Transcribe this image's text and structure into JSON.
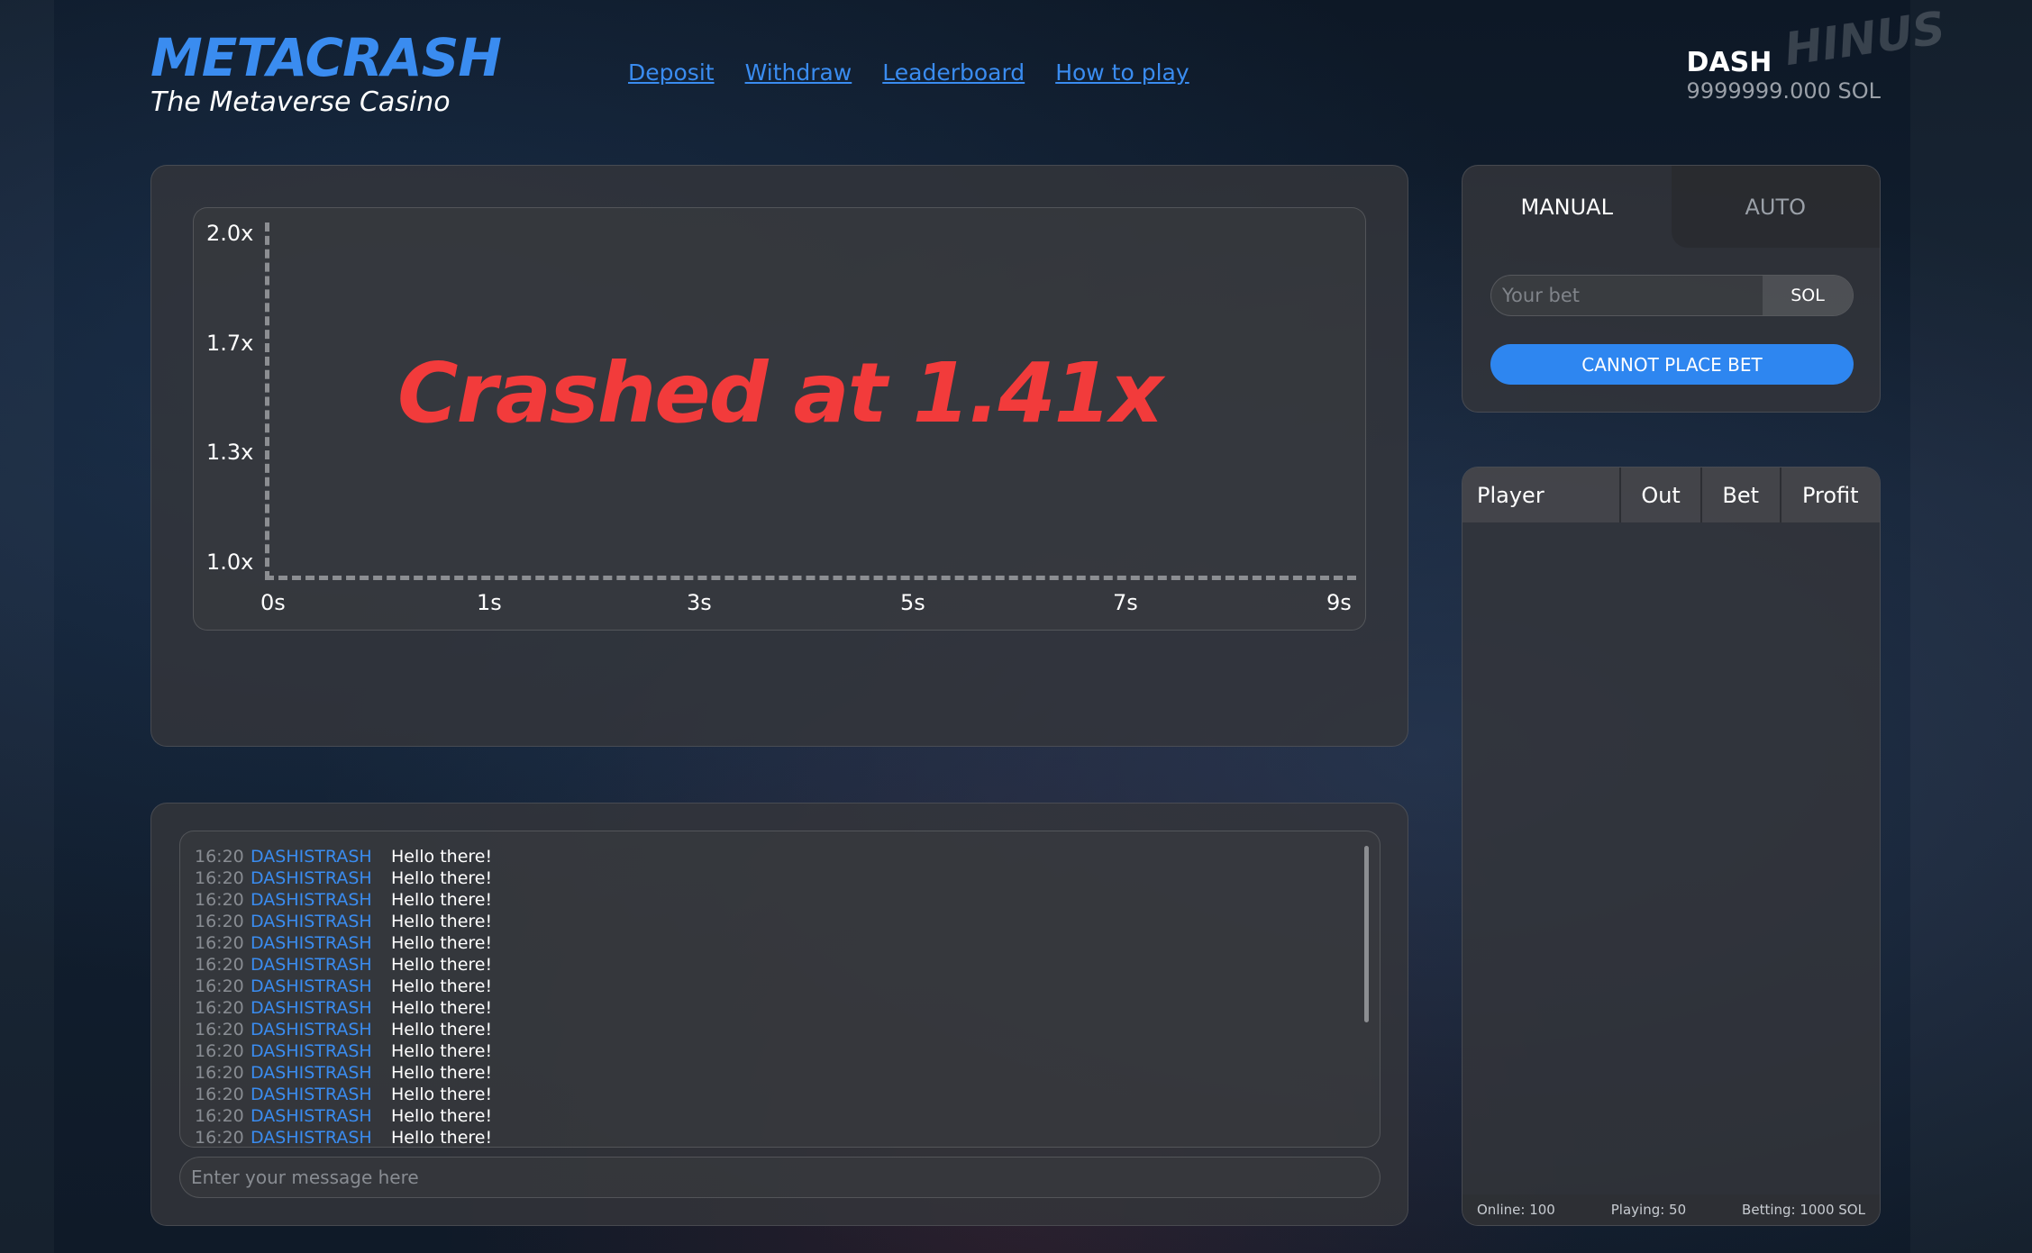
{
  "header": {
    "logo_title": "METACRASH",
    "logo_subtitle": "The Metaverse Casino",
    "nav": [
      "Deposit",
      "Withdraw",
      "Leaderboard",
      "How to play"
    ],
    "user_name": "DASH",
    "user_balance": "9999999.000 SOL",
    "watermark": "HINUS"
  },
  "game": {
    "y_ticks": [
      "2.0x",
      "1.7x",
      "1.3x",
      "1.0x"
    ],
    "x_ticks": [
      "0s",
      "1s",
      "3s",
      "5s",
      "7s",
      "9s"
    ],
    "crash_text": "Crashed at 1.41x",
    "crash_multiplier": 1.41
  },
  "chat": {
    "messages": [
      {
        "time": "16:20",
        "user": "DASHISTRASH",
        "text": "Hello there!"
      },
      {
        "time": "16:20",
        "user": "DASHISTRASH",
        "text": "Hello there!"
      },
      {
        "time": "16:20",
        "user": "DASHISTRASH",
        "text": "Hello there!"
      },
      {
        "time": "16:20",
        "user": "DASHISTRASH",
        "text": "Hello there!"
      },
      {
        "time": "16:20",
        "user": "DASHISTRASH",
        "text": "Hello there!"
      },
      {
        "time": "16:20",
        "user": "DASHISTRASH",
        "text": "Hello there!"
      },
      {
        "time": "16:20",
        "user": "DASHISTRASH",
        "text": "Hello there!"
      },
      {
        "time": "16:20",
        "user": "DASHISTRASH",
        "text": "Hello there!"
      },
      {
        "time": "16:20",
        "user": "DASHISTRASH",
        "text": "Hello there!"
      },
      {
        "time": "16:20",
        "user": "DASHISTRASH",
        "text": "Hello there!"
      },
      {
        "time": "16:20",
        "user": "DASHISTRASH",
        "text": "Hello there!"
      },
      {
        "time": "16:20",
        "user": "DASHISTRASH",
        "text": "Hello there!"
      },
      {
        "time": "16:20",
        "user": "DASHISTRASH",
        "text": "Hello there!"
      },
      {
        "time": "16:20",
        "user": "DASHISTRASH",
        "text": "Hello there!"
      }
    ],
    "input_placeholder": "Enter your message here"
  },
  "bet": {
    "tab_manual": "MANUAL",
    "tab_auto": "AUTO",
    "active_tab": "MANUAL",
    "bet_placeholder": "Your bet",
    "currency": "SOL",
    "button_label": "CANNOT PLACE BET"
  },
  "players": {
    "columns": [
      "Player",
      "Out",
      "Bet",
      "Profit"
    ],
    "rows": [],
    "online": "Online: 100",
    "playing": "Playing: 50",
    "betting": "Betting: 1000 SOL"
  },
  "colors": {
    "accent": "#3a8cf0",
    "crash": "#f23b3b",
    "button": "#2e86f0",
    "panel": "#34363a"
  }
}
